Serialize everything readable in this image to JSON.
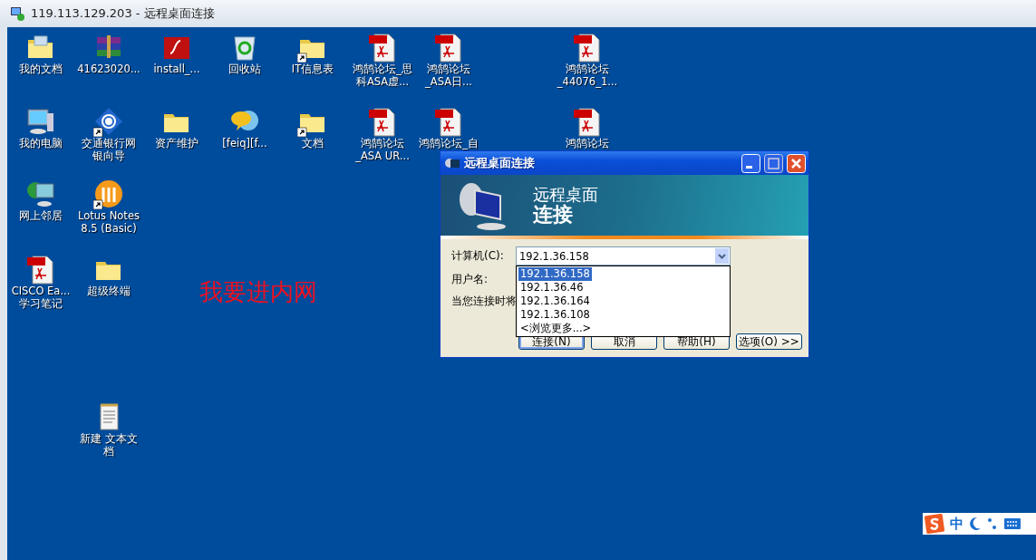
{
  "window": {
    "title": "119.113.129.203 - 远程桌面连接"
  },
  "desktop": {
    "icons": [
      {
        "kind": "documents",
        "label_lines": [
          "我的文档"
        ],
        "shortcut": false
      },
      {
        "kind": "archive",
        "label_lines": [
          "41623020..."
        ],
        "shortcut": false
      },
      {
        "kind": "flash",
        "label_lines": [
          "install_..."
        ],
        "shortcut": false
      },
      {
        "kind": "recycle",
        "label_lines": [
          "回收站"
        ],
        "shortcut": false
      },
      {
        "kind": "folder",
        "label_lines": [
          "IT信息表"
        ],
        "shortcut": true
      },
      {
        "kind": "pdf",
        "label_lines": [
          "鸿鹄论坛_思",
          "科ASA虚..."
        ],
        "shortcut": false
      },
      {
        "kind": "pdf",
        "label_lines": [
          "鸿鹄论坛",
          "_ASA日..."
        ],
        "shortcut": false
      },
      {
        "kind": "pdf",
        "label_lines": [
          "鸿鹄论坛",
          "_44076_1..."
        ],
        "shortcut": false
      },
      {
        "kind": "computer",
        "label_lines": [
          "我的电脑"
        ],
        "shortcut": false
      },
      {
        "kind": "bank",
        "label_lines": [
          "交通银行网",
          "银向导"
        ],
        "shortcut": true
      },
      {
        "kind": "folder",
        "label_lines": [
          "资产维护"
        ],
        "shortcut": false
      },
      {
        "kind": "chat",
        "label_lines": [
          "[feiq][f..."
        ],
        "shortcut": false
      },
      {
        "kind": "folder",
        "label_lines": [
          "文档"
        ],
        "shortcut": true
      },
      {
        "kind": "pdf",
        "label_lines": [
          "鸿鹄论坛",
          "_ASA UR..."
        ],
        "shortcut": false
      },
      {
        "kind": "pdf",
        "label_lines": [
          "鸿鹄论坛_自"
        ],
        "shortcut": false
      },
      {
        "kind": "pdf",
        "label_lines": [
          "鸿鹄论坛"
        ],
        "shortcut": false
      },
      {
        "kind": "network",
        "label_lines": [
          "网上邻居"
        ],
        "shortcut": false
      },
      {
        "kind": "lotus",
        "label_lines": [
          "Lotus Notes",
          "8.5 (Basic)"
        ],
        "shortcut": true
      },
      {
        "kind": "pdf",
        "label_lines": [
          "CISCO Ea...",
          "学习笔记"
        ],
        "shortcut": false
      },
      {
        "kind": "folder",
        "label_lines": [
          "超级终端"
        ],
        "shortcut": false
      },
      {
        "kind": "notepad",
        "label_lines": [
          "新建 文本文",
          "档"
        ],
        "shortcut": false
      }
    ],
    "note": "我要进内网"
  },
  "dialog": {
    "title": "远程桌面连接",
    "banner_lines": [
      "远程桌面",
      "连接"
    ],
    "computer_label": "计算机(C):",
    "computer_value": "192.1.36.158",
    "username_label": "用户名:",
    "hint": "当您连接时将",
    "dropdown": [
      {
        "text": "192.1.36.158",
        "selected": true
      },
      {
        "text": "192.1.36.46",
        "selected": false
      },
      {
        "text": "192.1.36.164",
        "selected": false
      },
      {
        "text": "192.1.36.108",
        "selected": false
      },
      {
        "text": "<浏览更多...>",
        "selected": false
      }
    ],
    "buttons": [
      {
        "label": "连接(N)",
        "default": true
      },
      {
        "label": "取消",
        "default": false
      },
      {
        "label": "帮助(H)",
        "default": false
      },
      {
        "label": "选项(O) >>",
        "default": false
      }
    ]
  },
  "ime": {
    "mode": "中"
  }
}
